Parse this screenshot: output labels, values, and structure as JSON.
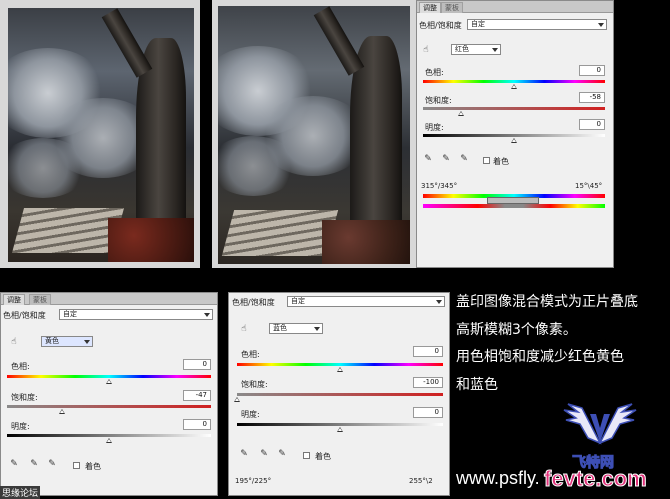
{
  "panel_large": {
    "tabs": [
      "调整",
      "蒙板"
    ],
    "title": "色相/饱和度",
    "preset": "自定",
    "channel": "红色",
    "hue_label": "色相:",
    "hue_value": "0",
    "sat_label": "饱和度:",
    "sat_value": "-58",
    "light_label": "明度:",
    "light_value": "0",
    "colorize_label": "着色",
    "range_left": "315°/345°",
    "range_right": "15°\\45°",
    "hue_pos": 0.5,
    "sat_pos": 0.21,
    "light_pos": 0.5
  },
  "panel_yellow": {
    "tabs": [
      "调整",
      "蒙板"
    ],
    "title": "色相/饱和度",
    "preset": "自定",
    "channel": "黄色",
    "hue_label": "色相:",
    "hue_value": "0",
    "sat_label": "饱和度:",
    "sat_value": "-47",
    "light_label": "明度:",
    "light_value": "0",
    "colorize_label": "着色",
    "hue_pos": 0.5,
    "sat_pos": 0.27,
    "light_pos": 0.5
  },
  "panel_blue": {
    "title": "色相/饱和度",
    "preset": "自定",
    "channel": "蓝色",
    "hue_label": "色相:",
    "hue_value": "0",
    "sat_label": "饱和度:",
    "sat_value": "-100",
    "light_label": "明度:",
    "light_value": "0",
    "colorize_label": "着色",
    "range_left": "195°/225°",
    "range_right": "255°\\2",
    "hue_pos": 0.5,
    "sat_pos": 0.0,
    "light_pos": 0.5
  },
  "caption": {
    "line1": "盖印图像混合模式为正片叠底",
    "line2": "高斯模糊3个像素。",
    "line3": "用色相饱和度减少红色黄色",
    "line4": "和蓝色"
  },
  "watermark": {
    "site": "www.psfly.",
    "brand": "fevte.com",
    "logo_text": "飞特网",
    "bottom_left": "思缘论坛"
  },
  "colors": {
    "panel_bg": "#f0f0f0",
    "brand_pink": "#e0317a",
    "logo_blue": "#3d4fb5"
  }
}
